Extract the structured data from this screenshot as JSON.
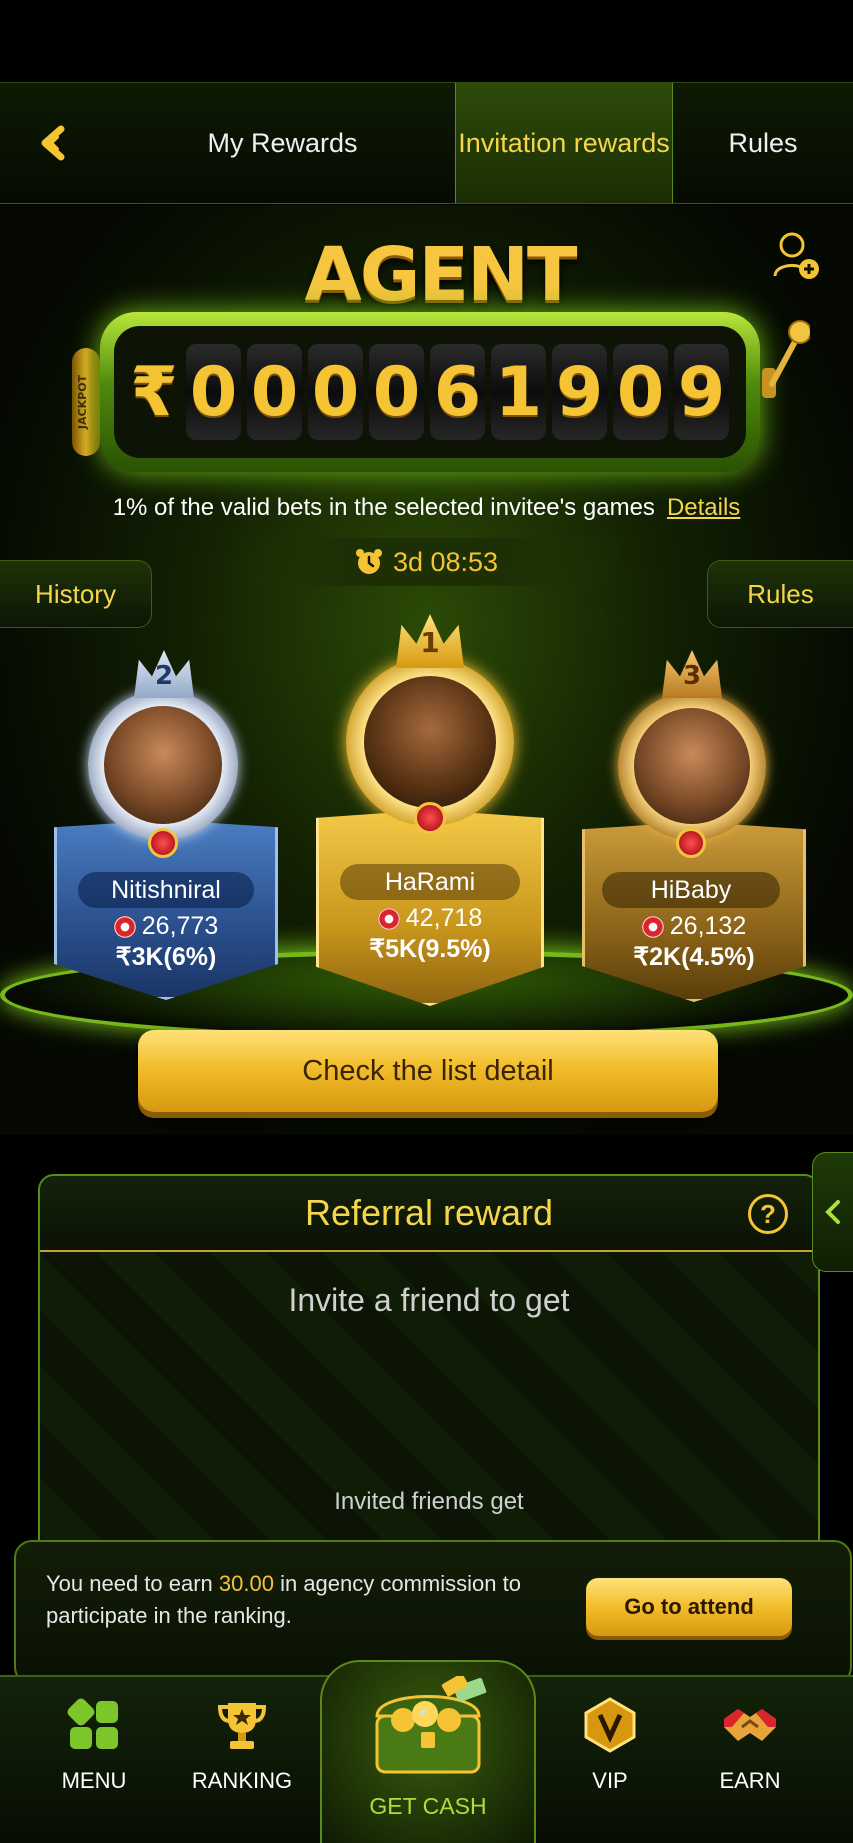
{
  "nav": {
    "tabs": [
      {
        "label": "My Rewards"
      },
      {
        "label": "Invitation rewards"
      },
      {
        "label": "Rules"
      }
    ]
  },
  "jackpot": {
    "title": "AGENT JACKPOT",
    "currency": "₹",
    "digits": [
      "0",
      "0",
      "0",
      "0",
      "6",
      "1",
      "9",
      "0",
      "9"
    ],
    "description": "1% of the valid bets in the selected invitee's games",
    "details_link": "Details",
    "timer": "3d 08:53",
    "history_label": "History",
    "rules_label": "Rules",
    "side_label": "JACKPOT"
  },
  "ranking": [
    {
      "rank": "2",
      "name": "Nitishniral",
      "score": "26,773",
      "reward": "₹3K(6%)"
    },
    {
      "rank": "1",
      "name": "HaRami",
      "score": "42,718",
      "reward": "₹5K(9.5%)"
    },
    {
      "rank": "3",
      "name": "HiBaby",
      "score": "26,132",
      "reward": "₹2K(4.5%)"
    }
  ],
  "check_list_label": "Check the list detail",
  "referral": {
    "title": "Referral reward",
    "help_icon": "?",
    "invite_text": "Invite a friend to get",
    "invited_text": "Invited friends get"
  },
  "commission": {
    "text_before": "You need to earn ",
    "amount": "30.00",
    "text_after": " in agency commission to participate in the ranking.",
    "button_label": "Go to attend"
  },
  "bottom_nav": {
    "menu": "MENU",
    "ranking": "RANKING",
    "get_cash": "GET CASH",
    "vip": "VIP",
    "earn": "EARN"
  },
  "colors": {
    "accent_gold": "#f5c434",
    "accent_green": "#76b81a",
    "background": "#000000"
  }
}
